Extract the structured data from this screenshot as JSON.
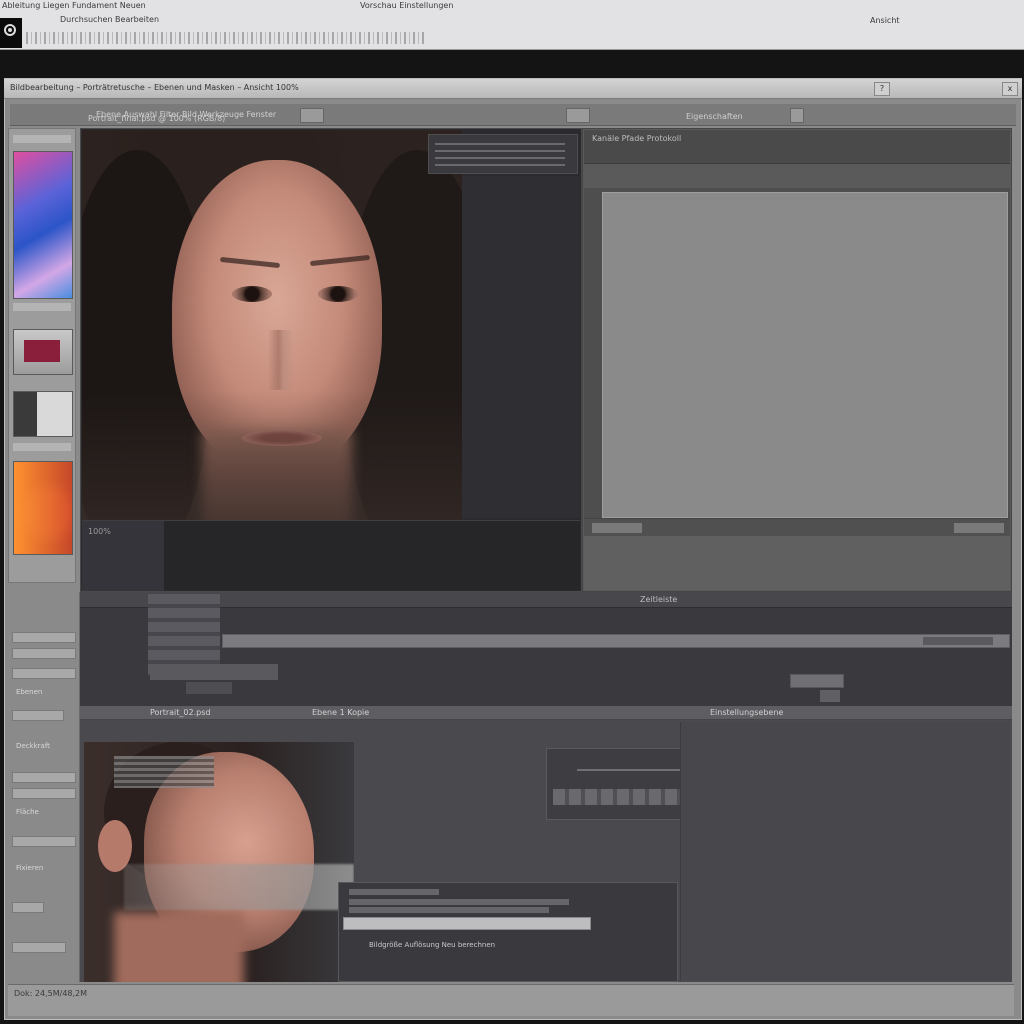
{
  "browser": {
    "line1_left": "Ableitung Liegen Fundament Neuen",
    "line1_center": "Vorschau Einstellungen",
    "line2_left": "Durchsuchen Bearbeiten",
    "line2_right": "Ansicht"
  },
  "window": {
    "title": "Bildbearbeitung – Porträtretusche – Ebenen und Masken – Ansicht 100%",
    "toolbar_text": "Ebene   Auswahl   Filter   Bild   Werkzeuge   Fenster",
    "right_tabs": "Eigenschaften",
    "controls": [
      "?",
      "x"
    ]
  },
  "viewer": {
    "header": "Portrait_final.psd @ 100% (RGB/8)",
    "bottom_text": "100%"
  },
  "right_panel": {
    "toolbar_text": "Kanäle   Pfade   Protokoll"
  },
  "mid": {
    "header": "Zeitleiste",
    "side_labels": [
      "Ebenen",
      "Deckkraft",
      "Fläche",
      "Fixieren"
    ]
  },
  "bottom": {
    "header_left": "Portrait_02.psd",
    "header_mid": "Ebene 1 Kopie",
    "header_right": "Einstellungsebene",
    "dialog_text": "Bildgröße   Auflösung   Neu berechnen"
  },
  "status": {
    "text": "Dok: 24,5M/48,2M"
  },
  "colors": {
    "window_bg": "#8a8a8a",
    "panel_dark": "#2b2b2f",
    "canvas_gray": "#8a8a8a"
  },
  "icons": [
    "app-logo-icon",
    "help-icon",
    "close-icon"
  ]
}
